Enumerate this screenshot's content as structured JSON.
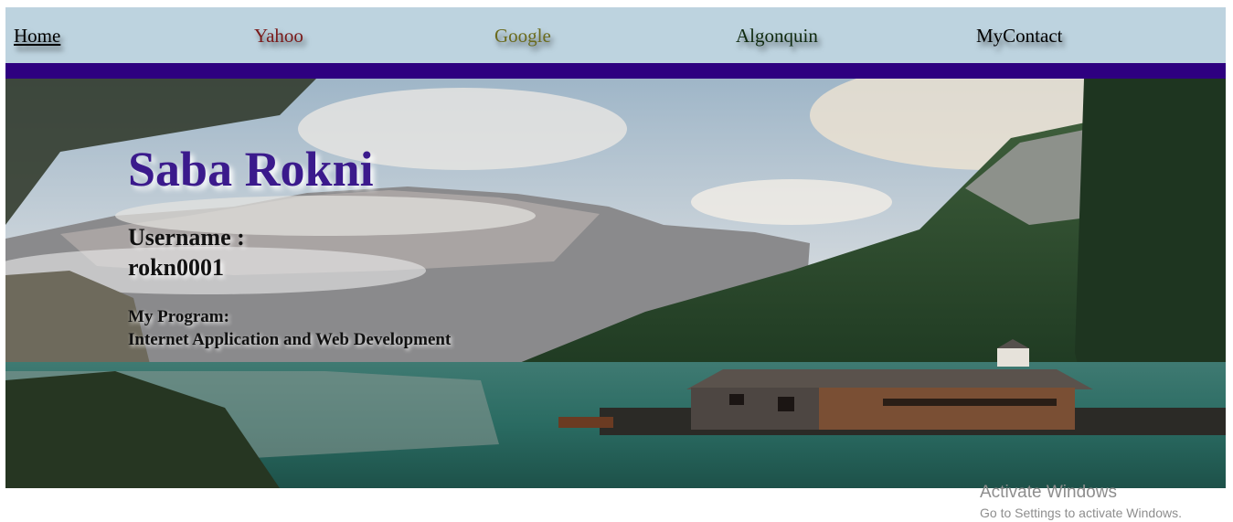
{
  "nav": {
    "items": [
      {
        "label": "Home",
        "color": "#000000"
      },
      {
        "label": "Yahoo",
        "color": "#7a1a1a"
      },
      {
        "label": "Google",
        "color": "#6b6b1e"
      },
      {
        "label": "Algonquin",
        "color": "#0f2a0f"
      },
      {
        "label": "MyContact",
        "color": "#000000"
      }
    ],
    "background_color": "#bdd3df",
    "rule_color": "#2e0080"
  },
  "hero": {
    "name": "Saba Rokni",
    "name_color": "#3b1a8c",
    "username_label": "Username :",
    "username": "rokn0001",
    "program_label": "My Program:",
    "program": "Internet Application and Web Development",
    "background_image": "mountain-lake-boathouse"
  },
  "watermark": {
    "title": "Activate Windows",
    "subtitle": "Go to Settings to activate Windows."
  }
}
